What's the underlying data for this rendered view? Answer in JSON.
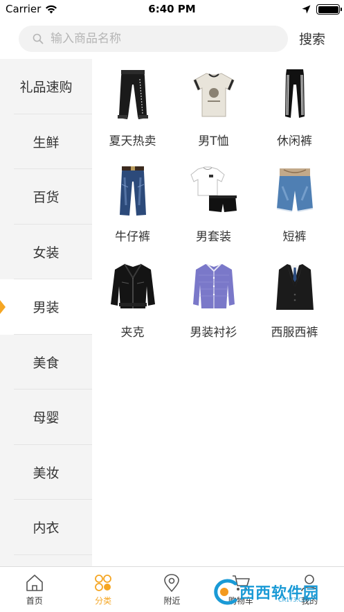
{
  "status_bar": {
    "carrier": "Carrier",
    "time": "6:40 PM",
    "icons": [
      "wifi-icon",
      "location-arrow-icon",
      "battery-icon"
    ]
  },
  "search": {
    "placeholder": "输入商品名称",
    "value": "",
    "button_label": "搜索",
    "icon": "search-icon"
  },
  "sidebar": {
    "active_index": 4,
    "items": [
      {
        "label": "礼品速购"
      },
      {
        "label": "生鲜"
      },
      {
        "label": "百货"
      },
      {
        "label": "女装"
      },
      {
        "label": "男装"
      },
      {
        "label": "美食"
      },
      {
        "label": "母婴"
      },
      {
        "label": "美妆"
      },
      {
        "label": "内衣"
      }
    ]
  },
  "products": [
    {
      "label": "夏天热卖",
      "icon": "jogger-pants-icon"
    },
    {
      "label": "男T恤",
      "icon": "tshirt-icon"
    },
    {
      "label": "休闲裤",
      "icon": "track-pants-icon"
    },
    {
      "label": "牛仔裤",
      "icon": "jeans-icon"
    },
    {
      "label": "男套装",
      "icon": "outfit-set-icon"
    },
    {
      "label": "短裤",
      "icon": "shorts-icon"
    },
    {
      "label": "夹克",
      "icon": "leather-jacket-icon"
    },
    {
      "label": "男装衬衫",
      "icon": "dress-shirt-icon"
    },
    {
      "label": "西服西裤",
      "icon": "suit-icon"
    }
  ],
  "tab_bar": {
    "active_index": 1,
    "accent_color": "#f5a623",
    "tabs": [
      {
        "label": "首页",
        "icon": "home-icon"
      },
      {
        "label": "分类",
        "icon": "category-icon"
      },
      {
        "label": "附近",
        "icon": "location-pin-icon"
      },
      {
        "label": "购物车",
        "icon": "cart-icon"
      },
      {
        "label": "我的",
        "icon": "profile-icon"
      }
    ]
  },
  "watermark": {
    "text": "西西软件园",
    "sub": "CR173.COM"
  }
}
